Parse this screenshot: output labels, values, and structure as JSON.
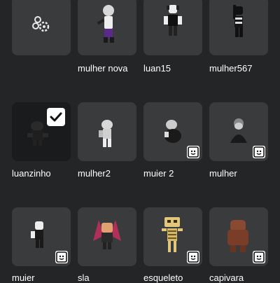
{
  "outfits": [
    {
      "name": "",
      "icon": "create-outfit-icon"
    },
    {
      "name": "mulher nova",
      "icon": "avatar-thumbnail"
    },
    {
      "name": "luan15",
      "icon": "avatar-thumbnail"
    },
    {
      "name": "mulher567",
      "icon": "avatar-thumbnail"
    },
    {
      "name": "luanzinho",
      "icon": "avatar-thumbnail",
      "selected": true
    },
    {
      "name": "mulher2",
      "icon": "avatar-thumbnail"
    },
    {
      "name": "muier 2",
      "icon": "avatar-thumbnail"
    },
    {
      "name": "mulher",
      "icon": "avatar-thumbnail"
    },
    {
      "name": "muier",
      "icon": "avatar-thumbnail"
    },
    {
      "name": "sla",
      "icon": "avatar-thumbnail"
    },
    {
      "name": "esqueleto",
      "icon": "avatar-thumbnail"
    },
    {
      "name": "capivara",
      "icon": "avatar-thumbnail"
    }
  ],
  "colors": {
    "background": "#232527",
    "tile": "#393b3d",
    "selected_tile": "#1a1b1d",
    "text": "#ffffff"
  }
}
